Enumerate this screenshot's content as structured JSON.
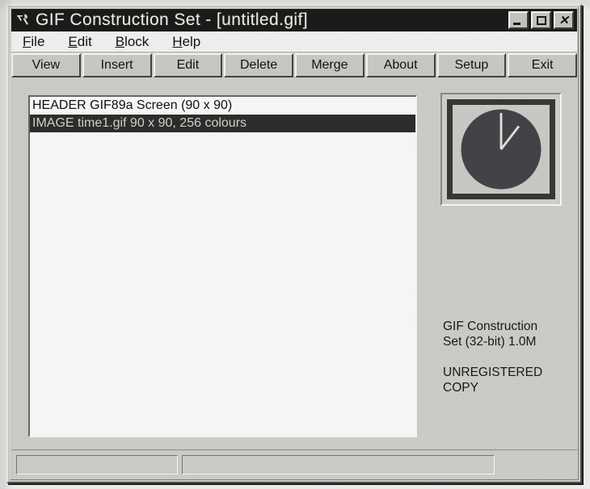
{
  "window": {
    "title": "GIF Construction Set - [untitled.gif]",
    "icon": "app-tool-icon",
    "controls": {
      "minimize": "_",
      "maximize": "□",
      "close": "×"
    }
  },
  "menu": {
    "items": [
      {
        "label": "File",
        "accel": "F"
      },
      {
        "label": "Edit",
        "accel": "E"
      },
      {
        "label": "Block",
        "accel": "B"
      },
      {
        "label": "Help",
        "accel": "H"
      }
    ]
  },
  "toolbar": {
    "buttons": [
      {
        "label": "View"
      },
      {
        "label": "Insert"
      },
      {
        "label": "Edit"
      },
      {
        "label": "Delete"
      },
      {
        "label": "Merge"
      },
      {
        "label": "About"
      },
      {
        "label": "Setup"
      },
      {
        "label": "Exit"
      }
    ]
  },
  "blocklist": {
    "rows": [
      {
        "text": "HEADER GIF89a Screen (90 x 90)",
        "selected": false
      },
      {
        "text": "IMAGE time1.gif 90 x 90, 256 colours",
        "selected": true
      }
    ]
  },
  "preview": {
    "name": "clock-thumbnail",
    "description": "clock face",
    "dial_color": "#46464a",
    "hand_color": "#e8e8e4",
    "frame_color": "#3a3a38"
  },
  "info": {
    "line1": "GIF Construction",
    "line2": "Set (32-bit) 1.0M",
    "line3": "UNREGISTERED",
    "line4": "COPY"
  },
  "statusbar": {
    "left": "",
    "right": ""
  }
}
